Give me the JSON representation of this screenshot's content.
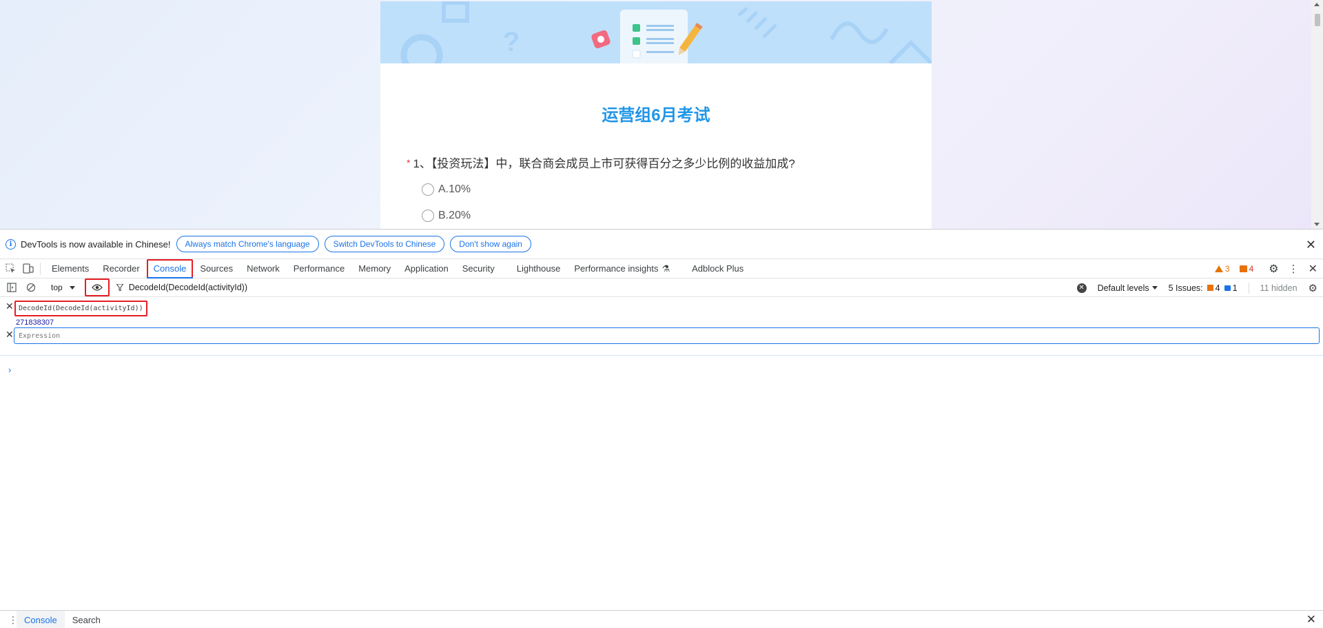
{
  "page": {
    "survey_title": "运营组6月考试",
    "question": {
      "required_mark": "*",
      "text": "1、【投资玩法】中，联合商会成员上市可获得百分之多少比例的收益加成?"
    },
    "options": [
      "A.10%",
      "B.20%"
    ]
  },
  "infobar": {
    "message": "DevTools is now available in Chinese!",
    "buttons": [
      "Always match Chrome's language",
      "Switch DevTools to Chinese",
      "Don't show again"
    ]
  },
  "tabs": [
    "Elements",
    "Recorder",
    "Console",
    "Sources",
    "Network",
    "Performance",
    "Memory",
    "Application",
    "Security",
    "Lighthouse",
    "Performance insights",
    "Adblock Plus"
  ],
  "active_tab": "Console",
  "counts": {
    "warnings": "3",
    "errors": "4"
  },
  "toolbar": {
    "context": "top",
    "filter_text": "DecodeId(DecodeId(activityId))",
    "levels": "Default levels",
    "issues_label": "5 Issues:",
    "issues_err": "4",
    "issues_info": "1",
    "hidden": "11 hidden"
  },
  "watch": {
    "expression": "DecodeId(DecodeId(activityId))",
    "value": "271838307",
    "input_placeholder": "Expression"
  },
  "prompt": "›",
  "drawer": {
    "tabs": [
      "Console",
      "Search"
    ]
  },
  "colors": {
    "accent": "#1a73e8",
    "highlight": "#e51c23",
    "title": "#2196e8"
  }
}
